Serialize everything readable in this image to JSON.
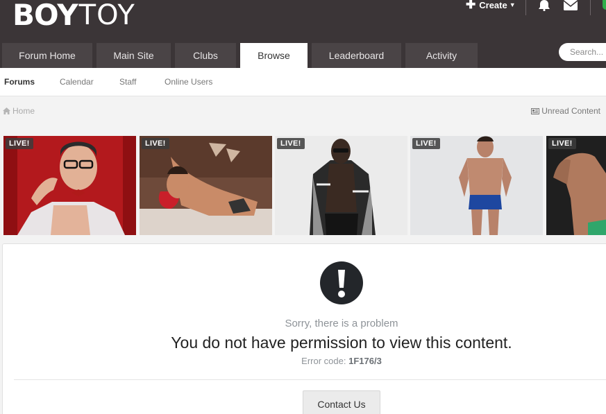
{
  "header": {
    "logo": {
      "left": "BOY",
      "right": "TOY"
    },
    "create_label": "Create",
    "search_placeholder": "Search..."
  },
  "main_tabs": [
    {
      "label": "Forum Home",
      "width": 130
    },
    {
      "label": "Main Site",
      "width": 107
    },
    {
      "label": "Clubs",
      "width": 88
    },
    {
      "label": "Browse",
      "width": 97,
      "active": true
    },
    {
      "label": "Leaderboard",
      "width": 129
    },
    {
      "label": "Activity",
      "width": 104
    }
  ],
  "sub_nav": [
    {
      "label": "Forums",
      "active": true
    },
    {
      "label": "Calendar"
    },
    {
      "label": "Staff"
    },
    {
      "label": "Online Users"
    }
  ],
  "breadcrumb": {
    "home": "Home"
  },
  "unread_label": "Unread Content",
  "cams": [
    {
      "badge": "LIVE!",
      "bg": "#b3191d"
    },
    {
      "badge": "LIVE!",
      "bg": "#6e4a3a"
    },
    {
      "badge": "LIVE!",
      "bg": "#ebebeb"
    },
    {
      "badge": "LIVE!",
      "bg": "#e4e5e7"
    },
    {
      "badge": "LIVE!",
      "bg": "#1f1f1f"
    }
  ],
  "error": {
    "sorry": "Sorry, there is a problem",
    "message": "You do not have permission to view this content.",
    "code_label": "Error code:",
    "code": "1F176/3",
    "contact": "Contact Us"
  },
  "colors": {
    "header_bg": "#3b3537",
    "tab_bg": "#4a4446",
    "status_dot": "#2fae4a"
  }
}
